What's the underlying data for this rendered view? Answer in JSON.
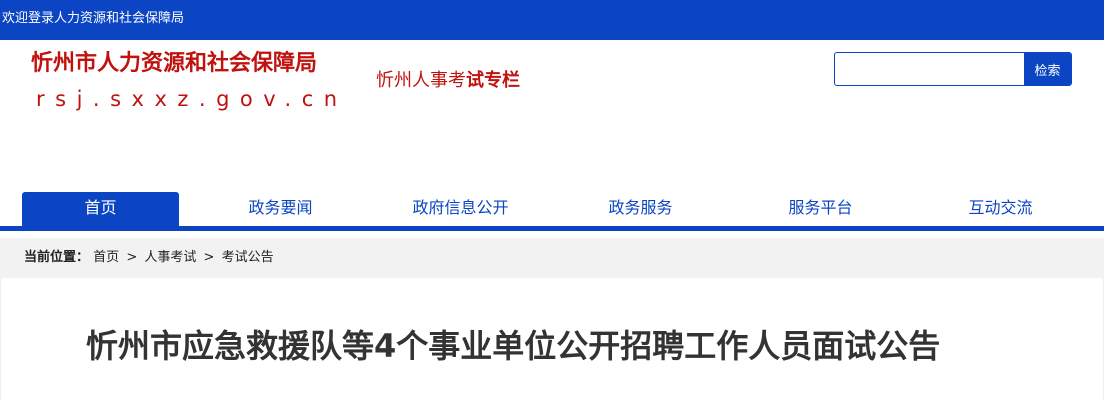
{
  "topbar": {
    "welcome": "欢迎登录人力资源和社会保障局"
  },
  "brand": {
    "title": "忻州市人力资源和社会保障局",
    "url": "rsj.sxxz.gov.cn",
    "column_prefix": "忻州人事考",
    "column_suffix": "试专栏"
  },
  "search": {
    "value": "",
    "placeholder": "",
    "button_label": "检索"
  },
  "nav": {
    "items": [
      {
        "label": "首页"
      },
      {
        "label": "政务要闻"
      },
      {
        "label": "政府信息公开"
      },
      {
        "label": "政务服务"
      },
      {
        "label": "服务平台"
      },
      {
        "label": "互动交流"
      }
    ]
  },
  "breadcrumb": {
    "label": "当前位置：",
    "items": [
      "首页",
      "人事考试",
      "考试公告"
    ],
    "separator": ">"
  },
  "article": {
    "title": "忻州市应急救援队等4个事业单位公开招聘工作人员面试公告"
  },
  "colors": {
    "brand_blue": "#0c45c4",
    "brand_red": "#c0130f"
  }
}
